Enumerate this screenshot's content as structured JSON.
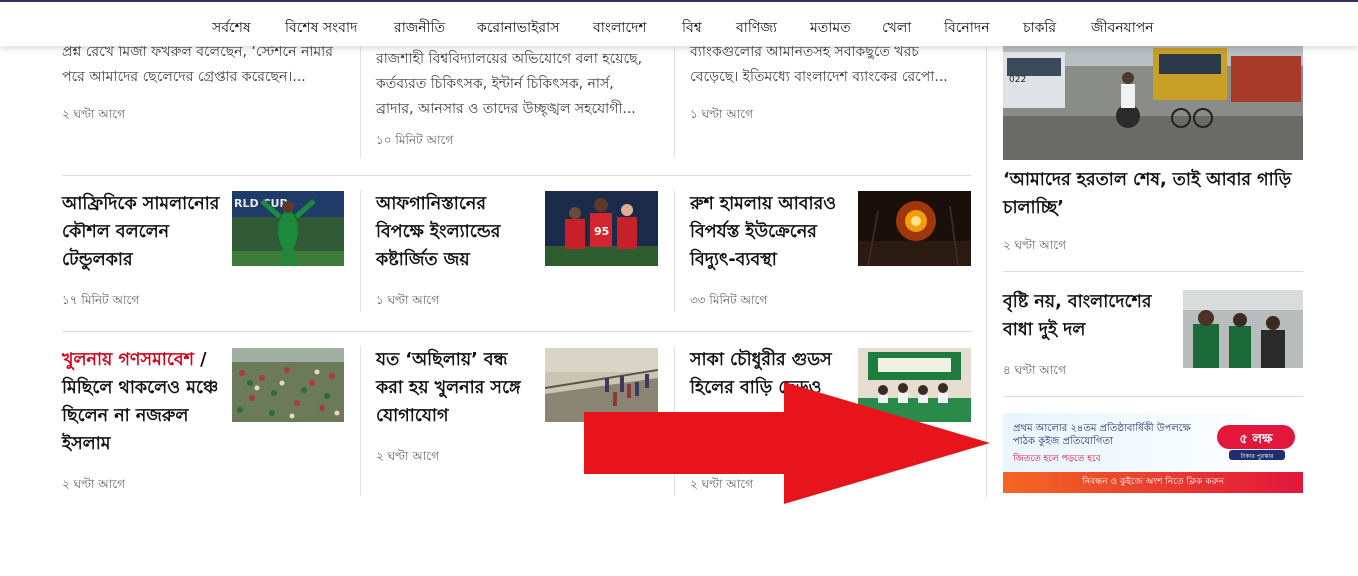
{
  "nav": {
    "items": [
      "সর্বশেষ",
      "বিশেষ সংবাদ",
      "রাজনীতি",
      "করোনাভাইরাস",
      "বাংলাদেশ",
      "বিশ্ব",
      "বাণিজ্য",
      "মতামত",
      "খেলা",
      "বিনোদন",
      "চাকরি",
      "জীবনযাপন"
    ]
  },
  "top_row": [
    {
      "lines": [
        "প্রশ্ন রেখে মির্জা ফখরুল বলেছেন, ‘স্টেশনে নামার",
        "পরে আমাদের ছেলেদের গ্রেপ্তার করেছেন।..."
      ],
      "time": "২ ঘণ্টা আগে"
    },
    {
      "lines": [
        "রাজশাহী বিশ্ববিদ্যালয়ের অভিযোগে বলা হয়েছে,",
        "কর্তব্যরত চিকিৎসক, ইন্টার্ন চিকিৎসক, নার্স,",
        "ব্রাদার, আনসার ও তাদের উচ্ছৃঙ্খল সহযোগী..."
      ],
      "time": "১০ মিনিট আগে"
    },
    {
      "lines": [
        "ব্যাংকগুলোর আমানতসহ সবকিছুতে খরচ",
        "বেড়েছে। ইতিমধ্যে বাংলাদেশ ব্যাংকের রেপো..."
      ],
      "time": "১ ঘণ্টা আগে"
    }
  ],
  "middle_row": [
    {
      "headline": [
        "আফ্রিদিকে সামলানোর",
        "কৌশল বললেন",
        "টেন্ডুলকার"
      ],
      "time": "১৭ মিনিট আগে"
    },
    {
      "headline": [
        "আফগানিস্তানের",
        "বিপক্ষে ইংল্যান্ডের",
        "কষ্টার্জিত জয়"
      ],
      "time": "১ ঘণ্টা আগে"
    },
    {
      "headline": [
        "রুশ হামলায় আবারও",
        "বিপর্যস্ত ইউক্রেনের",
        "বিদ্যুৎ-ব্যবস্থা"
      ],
      "time": "৩৩ মিনিট আগে"
    }
  ],
  "bottom_row": [
    {
      "kicker": "খুলনায় গণসমাবেশ",
      "separator": " /",
      "headline": [
        "মিছিলে থাকলেও মঞ্চে",
        "ছিলেন না নজরুল",
        "ইসলাম"
      ],
      "time": "২ ঘণ্টা আগে"
    },
    {
      "headline": [
        "যত ‘অছিলায়’ বন্ধ",
        "করা হয় খুলনার সঙ্গে",
        "যোগাযোগ"
      ],
      "time": "২ ঘণ্টা আগে"
    },
    {
      "headline": [
        "সাকা চৌধুরীর গুডস",
        "হিলের বাড়ি ছেড়ও"
      ],
      "time": "২ ঘণ্টা আগে"
    }
  ],
  "sidebar": [
    {
      "headline": [
        "‘আমাদের হরতাল শেষ, তাই আবার গাড়ি",
        "চালাচ্ছি’"
      ],
      "time": "২ ঘণ্টা আগে"
    },
    {
      "headline": [
        "বৃষ্টি নয়, বাংলাদেশের",
        "বাধা দুই দল"
      ],
      "time": "৪ ঘণ্টা আগে"
    }
  ],
  "ad": {
    "line1": "প্রথম আলোর ২৪তম প্রতিষ্ঠাবার্ষিকী উপলক্ষে পাঠক কুইজ প্রতিযোগিতা",
    "line2": "জিততে হলে পড়তে হবে",
    "logo_text": "৫ লক্ষ",
    "logo_sub": "টাকার পুরস্কার",
    "footer": "নিবন্ধন ও কুইজে অংশ নিতে ক্লিক করুন"
  },
  "colors": {
    "kicker": "#d0021b",
    "arrow": "#e8141c",
    "nav_border": "#3a2d5c"
  }
}
